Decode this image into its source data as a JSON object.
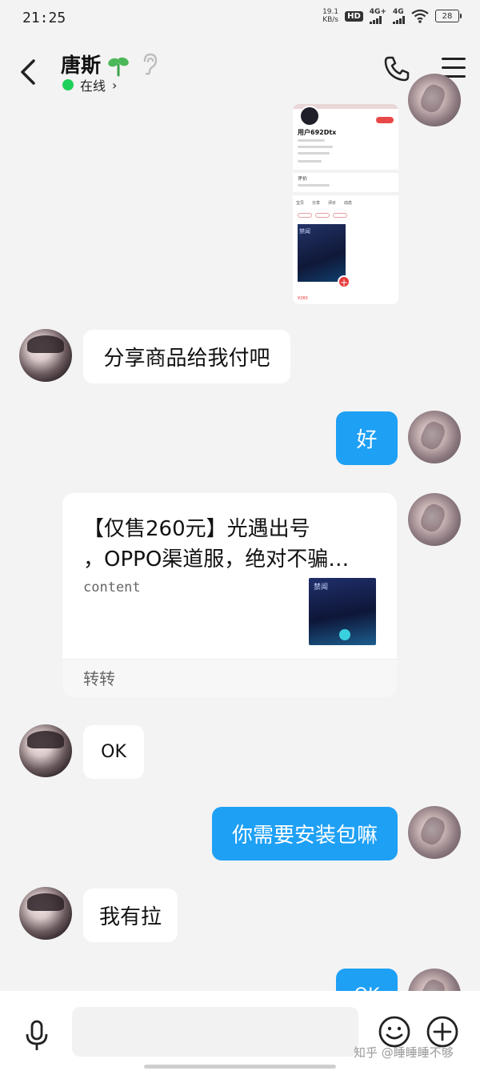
{
  "status_bar": {
    "time": "21:25",
    "net_speed_value": "19.1",
    "net_speed_unit": "KB/s",
    "hd_label": "HD",
    "signal1_label": "4G+",
    "signal2_label": "4G",
    "battery": "28"
  },
  "header": {
    "contact_name": "唐斯",
    "online_status": "在线",
    "online_color": "#1ed05a"
  },
  "shared_screenshot": {
    "user_name": "用户692Dtx",
    "section_label": "评价",
    "tabs": [
      "宝贝",
      "分享",
      "评价",
      "动态"
    ],
    "product_title": "禁闻",
    "price": "¥260"
  },
  "messages": [
    {
      "sender": "contact",
      "text": "分享商品给我付吧"
    },
    {
      "sender": "me",
      "text": "好"
    },
    {
      "sender": "contact",
      "text": "OK"
    },
    {
      "sender": "me",
      "text": "你需要安装包嘛"
    },
    {
      "sender": "contact",
      "text": "我有拉"
    },
    {
      "sender": "me",
      "text": "OK"
    }
  ],
  "product_card": {
    "title_line1": "【仅售260元】光遇出号",
    "title_line2": "，OPPO渠道服，绝对不骗…",
    "description": "content",
    "thumb_label": "禁闻",
    "footer": "转转"
  },
  "input_bar": {
    "placeholder": ""
  },
  "watermark": "知乎 @睡睡睡不够",
  "colors": {
    "outgoing_bubble": "#1ea0f5",
    "incoming_bubble": "#ffffff",
    "background": "#f3f3f3"
  }
}
